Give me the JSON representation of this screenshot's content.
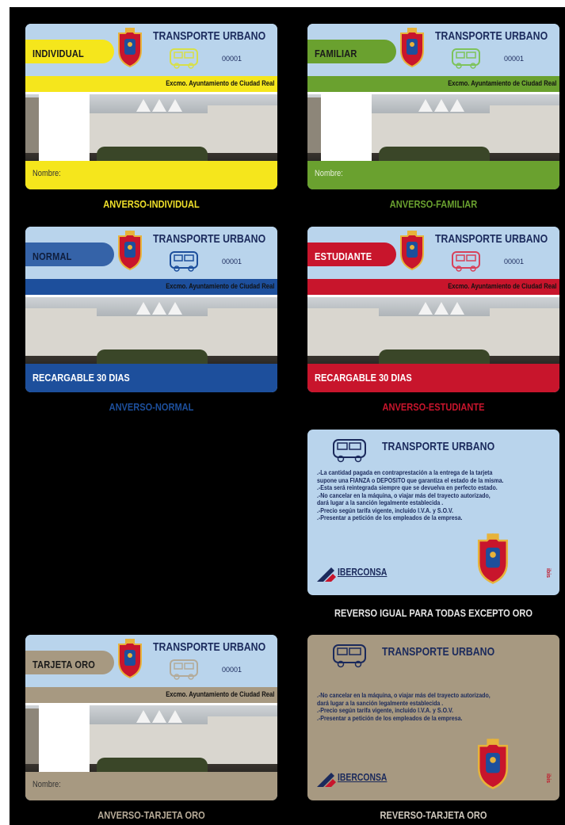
{
  "common": {
    "title": "TRANSPORTE URBANO",
    "serial": "00001",
    "ayuntamiento": "Excmo. Ayuntamiento de Ciudad Real"
  },
  "cards": [
    {
      "type": "INDIVIDUAL",
      "bottom": "Nombre:",
      "caption": "ANVERSO-INDIVIDUAL",
      "color": "#f5e61c",
      "caption_color": "#f0e02a"
    },
    {
      "type": "FAMILIAR",
      "bottom": "Nombre:",
      "caption": "ANVERSO-FAMILIAR",
      "color": "#6aa12f",
      "caption_color": "#6aa12f"
    },
    {
      "type": "NORMAL",
      "bottom": "RECARGABLE 30 DIAS",
      "caption": "ANVERSO-NORMAL",
      "color": "#1d4f9c",
      "caption_color": "#1d4f9c"
    },
    {
      "type": "ESTUDIANTE",
      "bottom": "RECARGABLE 30 DIAS",
      "caption": "ANVERSO-ESTUDIANTE",
      "color": "#c8152c",
      "caption_color": "#c8152c"
    },
    {
      "type": "TARJETA ORO",
      "bottom": "Nombre:",
      "caption": "ANVERSO-TARJETA ORO",
      "color": "#a79981",
      "caption_color": "#b7ab98"
    }
  ],
  "reverse": {
    "title": "TRANSPORTE URBANO",
    "lines": [
      ".-La cantidad pagada en contraprestación a la entrega de la tarjeta",
      "supone una FIANZA o DEPOSITO que garantiza el estado de la misma.",
      ".-Esta será reintegrada siempre que se devuelva en perfecto estado.",
      ".-No cancelar en la máquina, o viajar más del trayecto autorizado,",
      "dará lugar a la sanción legalmente establecida .",
      ".-Precio según tarifa vigente, incluido I.V.A. y S.O.V.",
      ".-Presentar a petición de los empleados de la empresa."
    ],
    "logo": "IBERCONSA",
    "mark": "ibis",
    "caption": "REVERSO IGUAL PARA TODAS EXCEPTO ORO",
    "color": "#b9d4ec",
    "caption_color": "#e6e6e6"
  },
  "reverse_oro": {
    "title": "TRANSPORTE URBANO",
    "lines": [
      ".-No cancelar en la máquina, o viajar más del trayecto autorizado,",
      "dará lugar a la sanción legalmente establecida .",
      ".-Precio según tarifa vigente, incluido I.V.A. y S.O.V.",
      ".-Presentar a petición de los empleados de la empresa."
    ],
    "logo": "IBERCONSA",
    "mark": "ibis",
    "caption": "REVERSO-TARJETA ORO",
    "color": "#a79981",
    "caption_color": "#cfc8bd"
  }
}
